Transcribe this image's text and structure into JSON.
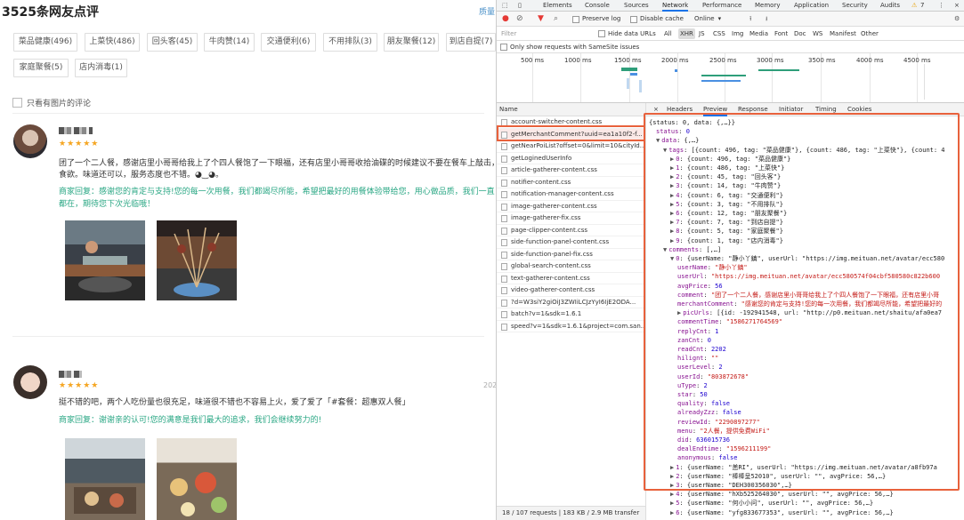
{
  "left": {
    "title": "3525条网友点评",
    "top_right_link": "质量",
    "tags": [
      "菜品健康(496)",
      "上菜快(486)",
      "回头客(45)",
      "牛肉赞(14)",
      "交通便利(6)",
      "不用排队(3)",
      "朋友聚餐(12)",
      "到店自提(7)",
      "家庭聚餐(5)",
      "店内消毒(1)"
    ],
    "pic_filter_label": "只看有图片的评论",
    "reviews": [
      {
        "username": "",
        "stars": "★★★★★",
        "text_line1": "团了一个二人餐，感谢店里小哥哥给我上了个四人餐饱了一下眼福，还有店里小哥哥收拾油碟的时候建议不要在餐车上敲击，",
        "text_line2": "食欲。味道还可以，服务态度也不错。◕‿◕。",
        "merchant_reply": "商家回复：感谢您的肯定与支持!您的每一次用餐，我们都竭尽所能，希望把最好的用餐体验带给您，用心做品质，我们一直都在，期待您下次光临哦！",
        "date": ""
      },
      {
        "username": "",
        "stars": "★★★★★",
        "text_line1": "挺不错的吧，两个人吃份量也很充足，味道很不错也不容易上火，爱了爱了「#套餐：超惠双人餐」",
        "merchant_reply": "商家回复：谢谢亲的认可!您的满意是我们最大的追求，我们会继续努力的!",
        "date": "202"
      }
    ]
  },
  "devtools": {
    "tabs": [
      "Elements",
      "Console",
      "Sources",
      "Network",
      "Performance",
      "Memory",
      "Application",
      "Security",
      "Audits"
    ],
    "active_tab": "Network",
    "warning_count": "7",
    "toolbar": {
      "preserve_log": "Preserve log",
      "disable_cache": "Disable cache",
      "throttle": "Online"
    },
    "filter": {
      "placeholder": "Filter",
      "hide_data_urls": "Hide data URLs",
      "types": [
        "All",
        "XHR",
        "JS",
        "CSS",
        "Img",
        "Media",
        "Font",
        "Doc",
        "WS",
        "Manifest",
        "Other"
      ],
      "active_type": "XHR"
    },
    "samesite_label": "Only show requests with SameSite issues",
    "timeline_ticks": [
      "500 ms",
      "1000 ms",
      "1500 ms",
      "2000 ms",
      "2500 ms",
      "3000 ms",
      "3500 ms",
      "4000 ms",
      "4500 ms"
    ],
    "list_header": "Name",
    "requests": [
      "account-switcher-content.css",
      "getMerchantComment?uuid=ea1a10f2-f...",
      "getNearPoiList?offset=0&limit=10&cityId...",
      "getLoginedUserInfo",
      "article-gatherer-content.css",
      "notifier-content.css",
      "notification-manager-content.css",
      "image-gatherer-content.css",
      "image-gatherer-fix.css",
      "page-clipper-content.css",
      "side-function-panel-content.css",
      "side-function-panel-fix.css",
      "global-search-content.css",
      "text-gatherer-content.css",
      "video-gatherer-content.css",
      "?d=W3siY2giOiJ3ZWIiLCJzYyI6IjE2ODA...",
      "batch?v=1&sdk=1.6.1",
      "speed?v=1&sdk=1.6.1&project=com.san..."
    ],
    "selected_request_index": 1,
    "status_bar": "18 / 107 requests  |  183 KB / 2.9 MB transfer",
    "detail_tabs": [
      "×",
      "Headers",
      "Preview",
      "Response",
      "Initiator",
      "Timing",
      "Cookies"
    ],
    "active_detail_tab": "Preview",
    "preview_lines": [
      {
        "indent": 0,
        "tri": "",
        "segs": [
          [
            "p",
            "{status: 0, data: {,…}}"
          ]
        ]
      },
      {
        "indent": 1,
        "tri": "",
        "segs": [
          [
            "k",
            "status"
          ],
          [
            "p",
            ": "
          ],
          [
            "n",
            "0"
          ]
        ]
      },
      {
        "indent": 1,
        "tri": "▼",
        "segs": [
          [
            "k",
            "data"
          ],
          [
            "p",
            ": {,…}"
          ]
        ]
      },
      {
        "indent": 2,
        "tri": "▼",
        "segs": [
          [
            "k",
            "tags"
          ],
          [
            "p",
            ": [{count: 496, tag: \"菜品健康\"}, {count: 486, tag: \"上菜快\"}, {count: 4"
          ]
        ]
      },
      {
        "indent": 3,
        "tri": "▶",
        "segs": [
          [
            "k",
            "0"
          ],
          [
            "p",
            ": {count: 496, tag: \"菜品健康\"}"
          ]
        ]
      },
      {
        "indent": 3,
        "tri": "▶",
        "segs": [
          [
            "k",
            "1"
          ],
          [
            "p",
            ": {count: 486, tag: \"上菜快\"}"
          ]
        ]
      },
      {
        "indent": 3,
        "tri": "▶",
        "segs": [
          [
            "k",
            "2"
          ],
          [
            "p",
            ": {count: 45, tag: \"回头客\"}"
          ]
        ]
      },
      {
        "indent": 3,
        "tri": "▶",
        "segs": [
          [
            "k",
            "3"
          ],
          [
            "p",
            ": {count: 14, tag: \"牛肉赞\"}"
          ]
        ]
      },
      {
        "indent": 3,
        "tri": "▶",
        "segs": [
          [
            "k",
            "4"
          ],
          [
            "p",
            ": {count: 6, tag: \"交通便利\"}"
          ]
        ]
      },
      {
        "indent": 3,
        "tri": "▶",
        "segs": [
          [
            "k",
            "5"
          ],
          [
            "p",
            ": {count: 3, tag: \"不用排队\"}"
          ]
        ]
      },
      {
        "indent": 3,
        "tri": "▶",
        "segs": [
          [
            "k",
            "6"
          ],
          [
            "p",
            ": {count: 12, tag: \"朋友聚餐\"}"
          ]
        ]
      },
      {
        "indent": 3,
        "tri": "▶",
        "segs": [
          [
            "k",
            "7"
          ],
          [
            "p",
            ": {count: 7, tag: \"到店自提\"}"
          ]
        ]
      },
      {
        "indent": 3,
        "tri": "▶",
        "segs": [
          [
            "k",
            "8"
          ],
          [
            "p",
            ": {count: 5, tag: \"家庭聚餐\"}"
          ]
        ]
      },
      {
        "indent": 3,
        "tri": "▶",
        "segs": [
          [
            "k",
            "9"
          ],
          [
            "p",
            ": {count: 1, tag: \"店内消毒\"}"
          ]
        ]
      },
      {
        "indent": 2,
        "tri": "▼",
        "segs": [
          [
            "k",
            "comments"
          ],
          [
            "p",
            ": [,…]"
          ]
        ]
      },
      {
        "indent": 3,
        "tri": "▼",
        "segs": [
          [
            "k",
            "0"
          ],
          [
            "p",
            ": {userName: \"静小丫鎮\", userUrl: \"https://img.meituan.net/avatar/ecc580"
          ]
        ]
      },
      {
        "indent": 4,
        "tri": "",
        "segs": [
          [
            "k",
            "userName"
          ],
          [
            "p",
            ": "
          ],
          [
            "s",
            "\"静小丫鎮\""
          ]
        ]
      },
      {
        "indent": 4,
        "tri": "",
        "segs": [
          [
            "k",
            "userUrl"
          ],
          [
            "p",
            ": "
          ],
          [
            "s",
            "\"https://img.meituan.net/avatar/ecc580574f04cbf580580c822b600"
          ]
        ]
      },
      {
        "indent": 4,
        "tri": "",
        "segs": [
          [
            "k",
            "avgPrice"
          ],
          [
            "p",
            ": "
          ],
          [
            "n",
            "56"
          ]
        ]
      },
      {
        "indent": 4,
        "tri": "",
        "segs": [
          [
            "k",
            "comment"
          ],
          [
            "p",
            ": "
          ],
          [
            "s",
            "\"团了一个二人餐，感谢店里小哥哥给我上了个四人餐饱了一下眼福，还有店里小哥"
          ]
        ]
      },
      {
        "indent": 4,
        "tri": "",
        "segs": [
          [
            "k",
            "merchantComment"
          ],
          [
            "p",
            ": "
          ],
          [
            "s",
            "\"感谢您的肯定与支持!您的每一次用餐，我们都竭尽所能，希望把最好的"
          ]
        ]
      },
      {
        "indent": 4,
        "tri": "▶",
        "segs": [
          [
            "k",
            "picUrls"
          ],
          [
            "p",
            ": [{id: -192941548, url: \"http://p0.meituan.net/shaitu/afa0ea7"
          ]
        ]
      },
      {
        "indent": 4,
        "tri": "",
        "segs": [
          [
            "k",
            "commentTime"
          ],
          [
            "p",
            ": "
          ],
          [
            "s",
            "\"1586271764569\""
          ]
        ]
      },
      {
        "indent": 4,
        "tri": "",
        "segs": [
          [
            "k",
            "replyCnt"
          ],
          [
            "p",
            ": "
          ],
          [
            "n",
            "1"
          ]
        ]
      },
      {
        "indent": 4,
        "tri": "",
        "segs": [
          [
            "k",
            "zanCnt"
          ],
          [
            "p",
            ": "
          ],
          [
            "n",
            "0"
          ]
        ]
      },
      {
        "indent": 4,
        "tri": "",
        "segs": [
          [
            "k",
            "readCnt"
          ],
          [
            "p",
            ": "
          ],
          [
            "n",
            "2202"
          ]
        ]
      },
      {
        "indent": 4,
        "tri": "",
        "segs": [
          [
            "k",
            "hilignt"
          ],
          [
            "p",
            ": "
          ],
          [
            "s",
            "\"\""
          ]
        ]
      },
      {
        "indent": 4,
        "tri": "",
        "segs": [
          [
            "k",
            "userLevel"
          ],
          [
            "p",
            ": "
          ],
          [
            "n",
            "2"
          ]
        ]
      },
      {
        "indent": 4,
        "tri": "",
        "segs": [
          [
            "k",
            "userId"
          ],
          [
            "p",
            ": "
          ],
          [
            "s",
            "\"803872678\""
          ]
        ]
      },
      {
        "indent": 4,
        "tri": "",
        "segs": [
          [
            "k",
            "uType"
          ],
          [
            "p",
            ": "
          ],
          [
            "n",
            "2"
          ]
        ]
      },
      {
        "indent": 4,
        "tri": "",
        "segs": [
          [
            "k",
            "star"
          ],
          [
            "p",
            ": "
          ],
          [
            "n",
            "50"
          ]
        ]
      },
      {
        "indent": 4,
        "tri": "",
        "segs": [
          [
            "k",
            "quality"
          ],
          [
            "p",
            ": "
          ],
          [
            "n",
            "false"
          ]
        ]
      },
      {
        "indent": 4,
        "tri": "",
        "segs": [
          [
            "k",
            "alreadyZzz"
          ],
          [
            "p",
            ": "
          ],
          [
            "n",
            "false"
          ]
        ]
      },
      {
        "indent": 4,
        "tri": "",
        "segs": [
          [
            "k",
            "reviewId"
          ],
          [
            "p",
            ": "
          ],
          [
            "s",
            "\"2290897277\""
          ]
        ]
      },
      {
        "indent": 4,
        "tri": "",
        "segs": [
          [
            "k",
            "menu"
          ],
          [
            "p",
            ": "
          ],
          [
            "s",
            "\"2人餐，提供免费WiFi\""
          ]
        ]
      },
      {
        "indent": 4,
        "tri": "",
        "segs": [
          [
            "k",
            "did"
          ],
          [
            "p",
            ": "
          ],
          [
            "n",
            "636015736"
          ]
        ]
      },
      {
        "indent": 4,
        "tri": "",
        "segs": [
          [
            "k",
            "dealEndtime"
          ],
          [
            "p",
            ": "
          ],
          [
            "s",
            "\"1596211199\""
          ]
        ]
      },
      {
        "indent": 4,
        "tri": "",
        "segs": [
          [
            "k",
            "anonymous"
          ],
          [
            "p",
            ": "
          ],
          [
            "n",
            "false"
          ]
        ]
      },
      {
        "indent": 3,
        "tri": "▶",
        "segs": [
          [
            "k",
            "1"
          ],
          [
            "p",
            ": {userName: \"恙RI\", userUrl: \"https://img.meituan.net/avatar/a8fb97a"
          ]
        ]
      },
      {
        "indent": 3,
        "tri": "▶",
        "segs": [
          [
            "k",
            "2"
          ],
          [
            "p",
            ": {userName: \"棒棒呈52010\", userUrl: \"\", avgPrice: 56,…}"
          ]
        ]
      },
      {
        "indent": 3,
        "tri": "▶",
        "segs": [
          [
            "k",
            "3"
          ],
          [
            "p",
            ": {userName: \"DEH300356030\",…}"
          ]
        ]
      },
      {
        "indent": 3,
        "tri": "▶",
        "segs": [
          [
            "k",
            "4"
          ],
          [
            "p",
            ": {userName: \"hXb525264030\", userUrl: \"\", avgPrice: 56,…}"
          ]
        ]
      },
      {
        "indent": 3,
        "tri": "▶",
        "segs": [
          [
            "k",
            "5"
          ],
          [
            "p",
            ": {userName: \"何小小问\", userUrl: \"\", avgPrice: 56,…}"
          ]
        ]
      },
      {
        "indent": 3,
        "tri": "▶",
        "segs": [
          [
            "k",
            "6"
          ],
          [
            "p",
            ": {userName: \"yfg833677353\", userUrl: \"\", avgPrice: 56,…}"
          ]
        ]
      }
    ]
  },
  "colors": {
    "highlight": "#e8613c",
    "accent": "#1a73e8",
    "reply": "#2aa784",
    "star": "#f5a623"
  }
}
